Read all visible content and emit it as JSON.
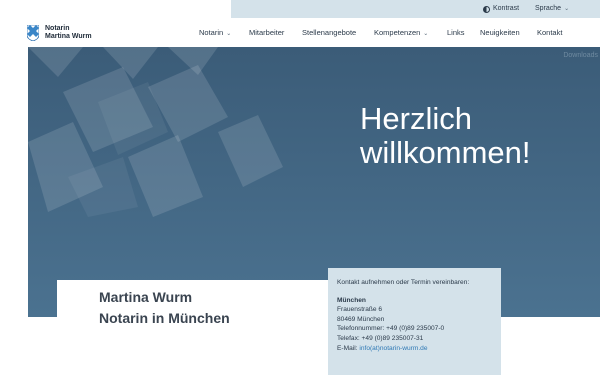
{
  "utility": {
    "contrast_label": "Kontrast",
    "language_label": "Sprache"
  },
  "logo": {
    "line1": "Notarin",
    "line2": "Martina Wurm"
  },
  "nav": {
    "items": [
      {
        "label": "Notarin",
        "dropdown": true
      },
      {
        "label": "Mitarbeiter",
        "dropdown": false
      },
      {
        "label": "Stellenangebote",
        "dropdown": false
      },
      {
        "label": "Kompetenzen",
        "dropdown": true
      },
      {
        "label": "Links",
        "dropdown": false
      },
      {
        "label": "Neuigkeiten",
        "dropdown": false
      },
      {
        "label": "Kontakt",
        "dropdown": false
      }
    ]
  },
  "hero": {
    "downloads_label": "Downloads",
    "title_line1": "Herzlich",
    "title_line2": "willkommen!"
  },
  "intro": {
    "line1": "Martina Wurm",
    "line2": "Notarin in München"
  },
  "contact": {
    "heading": "Kontakt aufnehmen oder Termin vereinbaren:",
    "city": "München",
    "street": "Frauenstraße 6",
    "zip_city": "80469 München",
    "phone": "Telefonnummer: +49 (0)89 235007-0",
    "fax": "Telefax: +49 (0)89 235007-31",
    "email_label": "E-Mail:",
    "email": "info(at)notarin-wurm.de"
  },
  "colors": {
    "hero_bg": "#3f6280",
    "utility_bg": "#d4e2ea",
    "link": "#2f79b5"
  }
}
